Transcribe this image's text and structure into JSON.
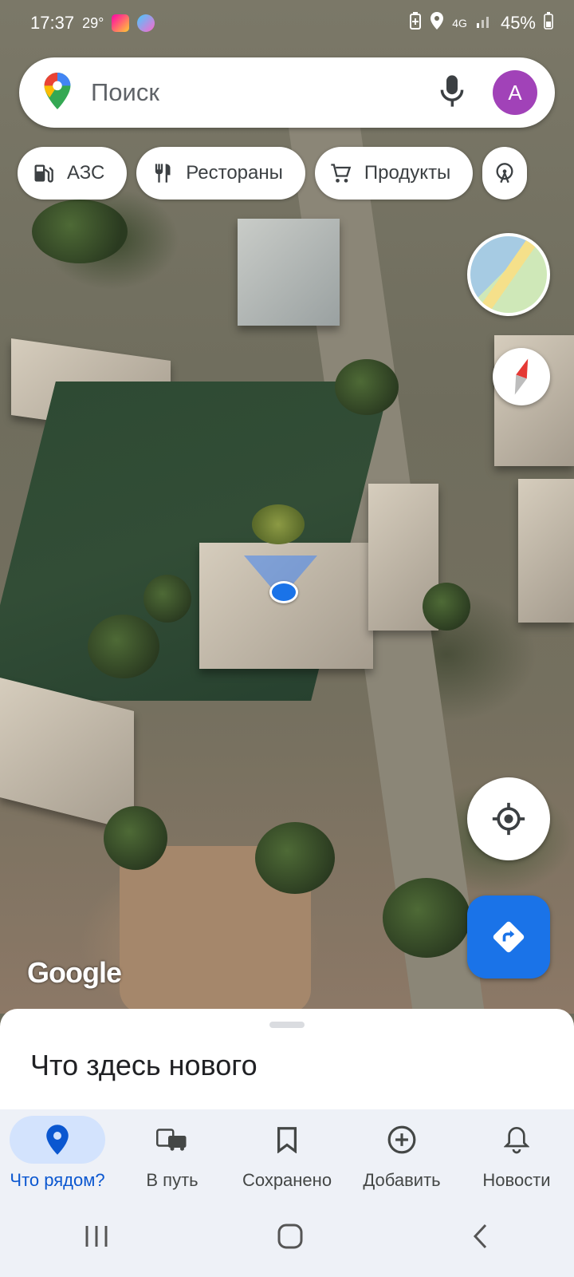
{
  "status_bar": {
    "time": "17:37",
    "temperature": "29°",
    "battery": "45%",
    "network": "4G"
  },
  "search": {
    "placeholder": "Поиск",
    "avatar_letter": "A"
  },
  "chips": [
    {
      "label": "АЗС",
      "icon": "gas-station-icon"
    },
    {
      "label": "Рестораны",
      "icon": "restaurant-icon"
    },
    {
      "label": "Продукты",
      "icon": "shopping-cart-icon"
    },
    {
      "label": "",
      "icon": "attraction-icon"
    }
  ],
  "map": {
    "attribution": "Google"
  },
  "sheet": {
    "title": "Что здесь нового"
  },
  "bottom_nav": {
    "items": [
      {
        "label": "Что рядом?",
        "icon": "location-pin-icon",
        "active": true
      },
      {
        "label": "В путь",
        "icon": "commute-icon",
        "active": false
      },
      {
        "label": "Сохранено",
        "icon": "bookmark-icon",
        "active": false
      },
      {
        "label": "Добавить",
        "icon": "add-circle-icon",
        "active": false
      },
      {
        "label": "Новости",
        "icon": "bell-icon",
        "active": false
      }
    ]
  },
  "colors": {
    "accent": "#1a73e8",
    "active_nav": "#0b57d0",
    "avatar": "#a142b8"
  }
}
